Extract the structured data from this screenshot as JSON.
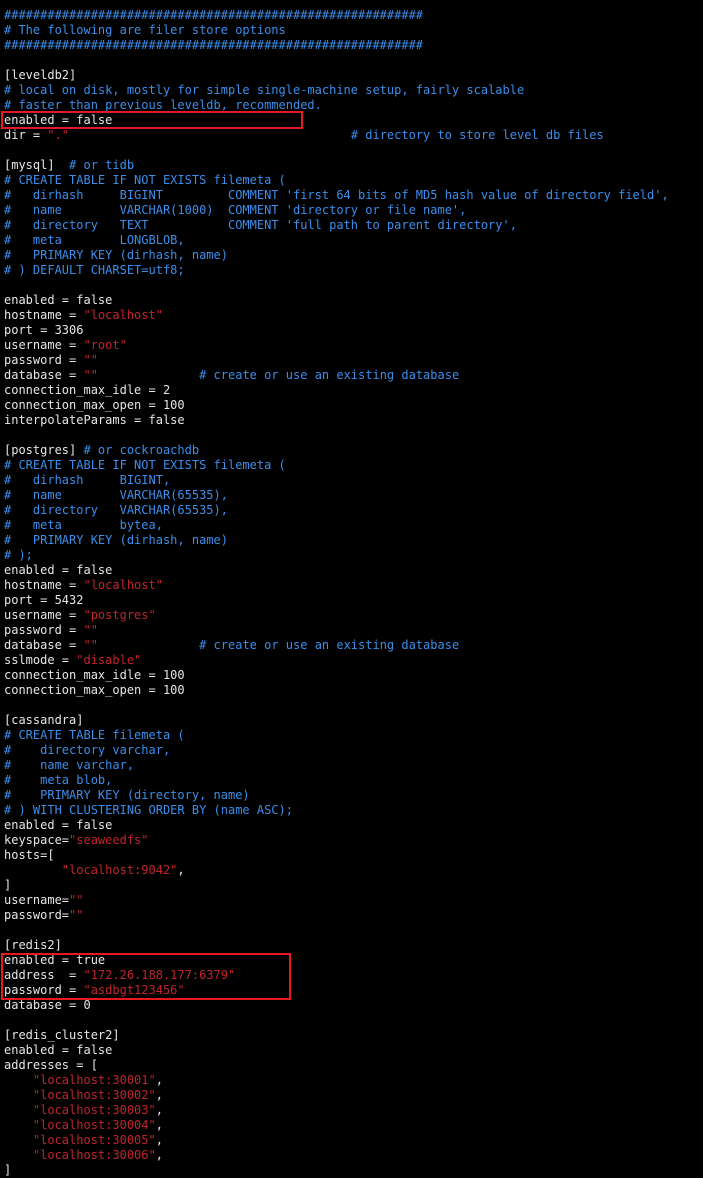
{
  "colors": {
    "background": "#000000",
    "default_text": "#e6e6e6",
    "comment": "#3b8eea",
    "string": "#c1242c",
    "highlight_box": "#e8181f"
  },
  "lines": [
    [
      {
        "t": "##########################################################",
        "c": "comment"
      }
    ],
    [
      {
        "t": "# The following are filer store options",
        "c": "comment"
      }
    ],
    [
      {
        "t": "##########################################################",
        "c": "comment"
      }
    ],
    [],
    [
      {
        "t": "[leveldb2]",
        "c": "default"
      }
    ],
    [
      {
        "t": "# local on disk, mostly for simple single-machine setup, fairly scalable",
        "c": "comment"
      }
    ],
    [
      {
        "t": "# faster than previous leveldb, recommended.",
        "c": "comment"
      }
    ],
    [
      {
        "t": "enabled = false",
        "c": "default"
      }
    ],
    [
      {
        "t": "dir = ",
        "c": "default"
      },
      {
        "t": "\".\"",
        "c": "string"
      },
      {
        "t": "                                       ",
        "c": "default"
      },
      {
        "t": "# directory to store level db files",
        "c": "comment"
      }
    ],
    [],
    [
      {
        "t": "[mysql]  ",
        "c": "default"
      },
      {
        "t": "# or tidb",
        "c": "comment"
      }
    ],
    [
      {
        "t": "# CREATE TABLE IF NOT EXISTS filemeta (",
        "c": "comment"
      }
    ],
    [
      {
        "t": "#   dirhash     BIGINT         COMMENT 'first 64 bits of MD5 hash value of directory field',",
        "c": "comment"
      }
    ],
    [
      {
        "t": "#   name        VARCHAR(1000)  COMMENT 'directory or file name',",
        "c": "comment"
      }
    ],
    [
      {
        "t": "#   directory   TEXT           COMMENT 'full path to parent directory',",
        "c": "comment"
      }
    ],
    [
      {
        "t": "#   meta        LONGBLOB,",
        "c": "comment"
      }
    ],
    [
      {
        "t": "#   PRIMARY KEY (dirhash, name)",
        "c": "comment"
      }
    ],
    [
      {
        "t": "# ) DEFAULT CHARSET=utf8;",
        "c": "comment"
      }
    ],
    [],
    [
      {
        "t": "enabled = false",
        "c": "default"
      }
    ],
    [
      {
        "t": "hostname = ",
        "c": "default"
      },
      {
        "t": "\"localhost\"",
        "c": "string"
      }
    ],
    [
      {
        "t": "port = 3306",
        "c": "default"
      }
    ],
    [
      {
        "t": "username = ",
        "c": "default"
      },
      {
        "t": "\"root\"",
        "c": "string"
      }
    ],
    [
      {
        "t": "password = ",
        "c": "default"
      },
      {
        "t": "\"\"",
        "c": "string"
      }
    ],
    [
      {
        "t": "database = ",
        "c": "default"
      },
      {
        "t": "\"\"",
        "c": "string"
      },
      {
        "t": "              ",
        "c": "default"
      },
      {
        "t": "# create or use an existing database",
        "c": "comment"
      }
    ],
    [
      {
        "t": "connection_max_idle = 2",
        "c": "default"
      }
    ],
    [
      {
        "t": "connection_max_open = 100",
        "c": "default"
      }
    ],
    [
      {
        "t": "interpolateParams = false",
        "c": "default"
      }
    ],
    [],
    [
      {
        "t": "[postgres] ",
        "c": "default"
      },
      {
        "t": "# or cockroachdb",
        "c": "comment"
      }
    ],
    [
      {
        "t": "# CREATE TABLE IF NOT EXISTS filemeta (",
        "c": "comment"
      }
    ],
    [
      {
        "t": "#   dirhash     BIGINT,",
        "c": "comment"
      }
    ],
    [
      {
        "t": "#   name        VARCHAR(65535),",
        "c": "comment"
      }
    ],
    [
      {
        "t": "#   directory   VARCHAR(65535),",
        "c": "comment"
      }
    ],
    [
      {
        "t": "#   meta        bytea,",
        "c": "comment"
      }
    ],
    [
      {
        "t": "#   PRIMARY KEY (dirhash, name)",
        "c": "comment"
      }
    ],
    [
      {
        "t": "# );",
        "c": "comment"
      }
    ],
    [
      {
        "t": "enabled = false",
        "c": "default"
      }
    ],
    [
      {
        "t": "hostname = ",
        "c": "default"
      },
      {
        "t": "\"localhost\"",
        "c": "string"
      }
    ],
    [
      {
        "t": "port = 5432",
        "c": "default"
      }
    ],
    [
      {
        "t": "username = ",
        "c": "default"
      },
      {
        "t": "\"postgres\"",
        "c": "string"
      }
    ],
    [
      {
        "t": "password = ",
        "c": "default"
      },
      {
        "t": "\"\"",
        "c": "string"
      }
    ],
    [
      {
        "t": "database = ",
        "c": "default"
      },
      {
        "t": "\"\"",
        "c": "string"
      },
      {
        "t": "              ",
        "c": "default"
      },
      {
        "t": "# create or use an existing database",
        "c": "comment"
      }
    ],
    [
      {
        "t": "sslmode = ",
        "c": "default"
      },
      {
        "t": "\"disable\"",
        "c": "string"
      }
    ],
    [
      {
        "t": "connection_max_idle = 100",
        "c": "default"
      }
    ],
    [
      {
        "t": "connection_max_open = 100",
        "c": "default"
      }
    ],
    [],
    [
      {
        "t": "[cassandra]",
        "c": "default"
      }
    ],
    [
      {
        "t": "# CREATE TABLE filemeta (",
        "c": "comment"
      }
    ],
    [
      {
        "t": "#    directory varchar,",
        "c": "comment"
      }
    ],
    [
      {
        "t": "#    name varchar,",
        "c": "comment"
      }
    ],
    [
      {
        "t": "#    meta blob,",
        "c": "comment"
      }
    ],
    [
      {
        "t": "#    PRIMARY KEY (directory, name)",
        "c": "comment"
      }
    ],
    [
      {
        "t": "# ) WITH CLUSTERING ORDER BY (name ASC);",
        "c": "comment"
      }
    ],
    [
      {
        "t": "enabled = false",
        "c": "default"
      }
    ],
    [
      {
        "t": "keyspace=",
        "c": "default"
      },
      {
        "t": "\"seaweedfs\"",
        "c": "string"
      }
    ],
    [
      {
        "t": "hosts=[",
        "c": "default"
      }
    ],
    [
      {
        "t": "        ",
        "c": "default"
      },
      {
        "t": "\"localhost:9042\"",
        "c": "string"
      },
      {
        "t": ",",
        "c": "default"
      }
    ],
    [
      {
        "t": "]",
        "c": "default"
      }
    ],
    [
      {
        "t": "username=",
        "c": "default"
      },
      {
        "t": "\"\"",
        "c": "string"
      }
    ],
    [
      {
        "t": "password=",
        "c": "default"
      },
      {
        "t": "\"\"",
        "c": "string"
      }
    ],
    [],
    [
      {
        "t": "[redis2]",
        "c": "default"
      }
    ],
    [
      {
        "t": "enabled = true",
        "c": "default"
      }
    ],
    [
      {
        "t": "address  = ",
        "c": "default"
      },
      {
        "t": "\"172.26.188.177:6379\"",
        "c": "string"
      }
    ],
    [
      {
        "t": "password = ",
        "c": "default"
      },
      {
        "t": "\"asdbgt123456\"",
        "c": "string"
      }
    ],
    [
      {
        "t": "database = 0",
        "c": "default"
      }
    ],
    [],
    [
      {
        "t": "[redis_cluster2]",
        "c": "default"
      }
    ],
    [
      {
        "t": "enabled = false",
        "c": "default"
      }
    ],
    [
      {
        "t": "addresses = [",
        "c": "default"
      }
    ],
    [
      {
        "t": "    ",
        "c": "default"
      },
      {
        "t": "\"localhost:30001\"",
        "c": "string"
      },
      {
        "t": ",",
        "c": "default"
      }
    ],
    [
      {
        "t": "    ",
        "c": "default"
      },
      {
        "t": "\"localhost:30002\"",
        "c": "string"
      },
      {
        "t": ",",
        "c": "default"
      }
    ],
    [
      {
        "t": "    ",
        "c": "default"
      },
      {
        "t": "\"localhost:30003\"",
        "c": "string"
      },
      {
        "t": ",",
        "c": "default"
      }
    ],
    [
      {
        "t": "    ",
        "c": "default"
      },
      {
        "t": "\"localhost:30004\"",
        "c": "string"
      },
      {
        "t": ",",
        "c": "default"
      }
    ],
    [
      {
        "t": "    ",
        "c": "default"
      },
      {
        "t": "\"localhost:30005\"",
        "c": "string"
      },
      {
        "t": ",",
        "c": "default"
      }
    ],
    [
      {
        "t": "    ",
        "c": "default"
      },
      {
        "t": "\"localhost:30006\"",
        "c": "string"
      },
      {
        "t": ",",
        "c": "default"
      }
    ],
    [
      {
        "t": "]",
        "c": "default"
      }
    ]
  ]
}
